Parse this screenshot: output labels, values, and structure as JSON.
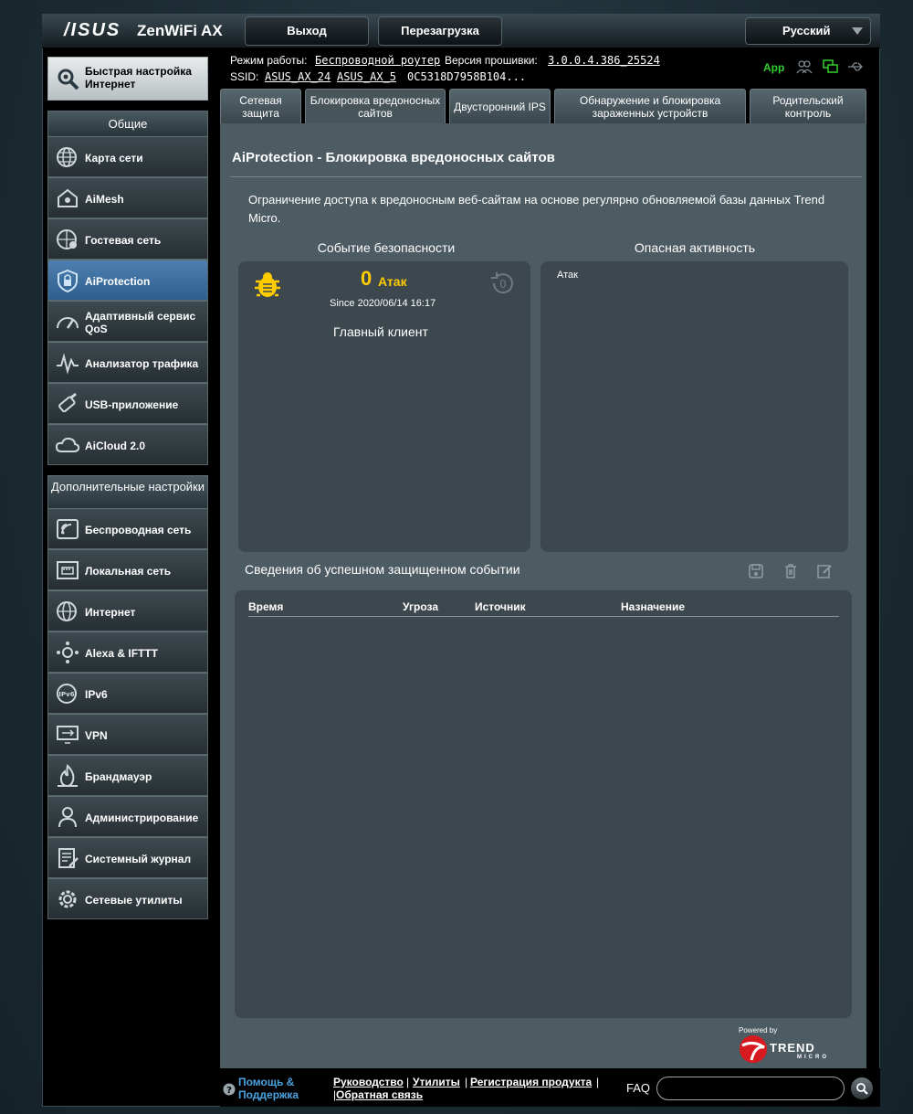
{
  "header": {
    "brand": "/ISUS",
    "model": "ZenWiFi AX",
    "logout_label": "Выход",
    "reboot_label": "Перезагрузка",
    "language": "Русский"
  },
  "status": {
    "mode_label": "Режим работы:",
    "mode_value": "Беспроводной роутер",
    "firmware_label": "Версия прошивки:",
    "firmware_value": "3.0.0.4.386_25524",
    "ssid_label": "SSID:",
    "ssid_1": "ASUS_AX_24",
    "ssid_2": "ASUS_AX_5",
    "ssid_3": "0C5318D7958B104...",
    "app_label": "App"
  },
  "sidebar": {
    "quick_setup": "Быстрая настройка Интернет",
    "general_header": "Общие",
    "general_items": [
      {
        "label": "Карта сети"
      },
      {
        "label": "AiMesh"
      },
      {
        "label": "Гостевая сеть"
      },
      {
        "label": "AiProtection"
      },
      {
        "label": "Адаптивный сервис QoS"
      },
      {
        "label": "Анализатор трафика"
      },
      {
        "label": "USB-приложение"
      },
      {
        "label": "AiCloud 2.0"
      }
    ],
    "advanced_header": "Дополнительные настройки",
    "advanced_items": [
      {
        "label": "Беспроводная сеть"
      },
      {
        "label": "Локальная сеть"
      },
      {
        "label": "Интернет"
      },
      {
        "label": "Alexa & IFTTT"
      },
      {
        "label": "IPv6"
      },
      {
        "label": "VPN"
      },
      {
        "label": "Брандмауэр"
      },
      {
        "label": "Администрирование"
      },
      {
        "label": "Системный журнал"
      },
      {
        "label": "Сетевые утилиты"
      }
    ]
  },
  "tabs": [
    {
      "label": "Сетевая защита"
    },
    {
      "label": "Блокировка вредоносных сайтов"
    },
    {
      "label": "Двусторонний IPS"
    },
    {
      "label": "Обнаружение и блокировка зараженных устройств"
    },
    {
      "label": "Родительский контроль"
    }
  ],
  "main": {
    "title": "AiProtection - Блокировка вредоносных сайтов",
    "description": "Ограничение доступа к вредоносным веб-сайтам на основе регулярно обновляемой базы данных Trend Micro.",
    "security_event_header": "Событие безопасности",
    "threat_activity_header": "Опасная активность",
    "attack_count": "0",
    "attack_label": "Атак",
    "since": "Since 2020/06/14 16:17",
    "main_client": "Главный клиент",
    "activity_legend": "Атак",
    "events_title": "Сведения об успешном защищенном событии",
    "table_headers": [
      "Время",
      "Угроза",
      "Источник",
      "Назначение"
    ],
    "powered_by": "Powered by",
    "trend": "TREND",
    "micro": "MICRO"
  },
  "footer": {
    "help": "Помощь & Поддержка",
    "manual": "Руководство",
    "utilities": "Утилиты",
    "registration": "Регистрация продукта",
    "feedback": "Обратная связь",
    "faq": "FAQ",
    "search_placeholder": ""
  },
  "colors": {
    "accent_yellow": "#ffcc00",
    "active_blue": "#3c6f9f",
    "app_green": "#2fd02f",
    "help_blue": "#4aa3e0"
  }
}
